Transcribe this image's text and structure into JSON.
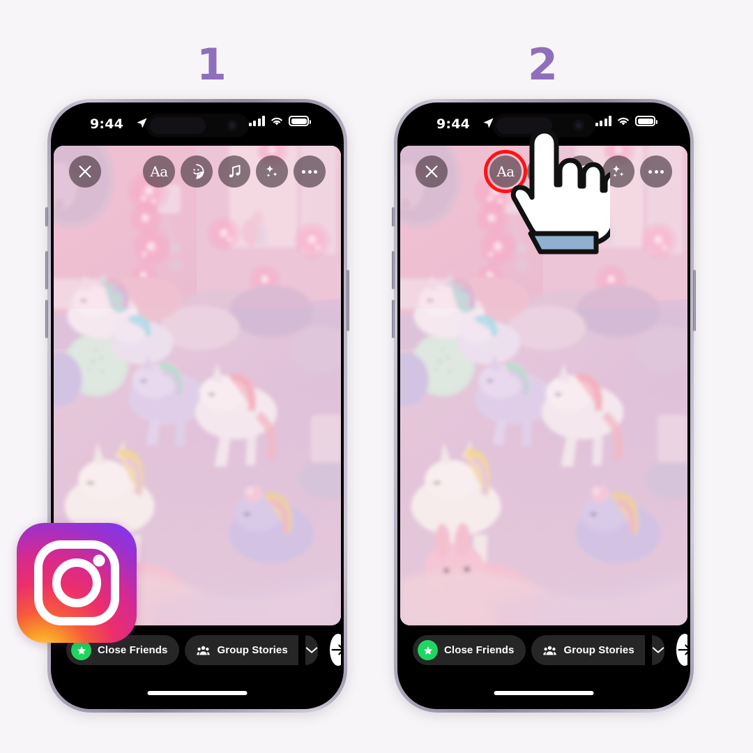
{
  "page": {
    "background_color": "#f7f5f7",
    "accent_color": "#8f6fbc",
    "highlight_color": "#ff1212"
  },
  "steps": [
    {
      "number": "1"
    },
    {
      "number": "2"
    }
  ],
  "status_bar": {
    "time": "9:44",
    "location_icon": "location-arrow-icon",
    "cellular_icon": "signal-bars-icon",
    "wifi_icon": "wifi-icon",
    "battery_icon": "battery-full-icon"
  },
  "story_editor": {
    "close_label": "close-icon",
    "tools": [
      {
        "name": "text-tool",
        "label": "Aa",
        "icon": "text-icon"
      },
      {
        "name": "sticker-tool",
        "label": "",
        "icon": "sticker-icon"
      },
      {
        "name": "music-tool",
        "label": "",
        "icon": "music-note-icon"
      },
      {
        "name": "effects-tool",
        "label": "",
        "icon": "sparkles-icon"
      },
      {
        "name": "more-tool",
        "label": "",
        "icon": "more-dots-icon"
      }
    ],
    "photo_description": "Pastel pink bedroom with unicorn plush toys on a bed, fairy lights on the wall, round mirror and framed art"
  },
  "bottom_bar": {
    "close_friends_label": "Close Friends",
    "close_friends_icon": "star-icon",
    "close_friends_badge_color": "#1ed760",
    "group_stories_label": "Group Stories",
    "group_stories_icon": "group-people-icon",
    "caret_icon": "chevron-down-icon",
    "send_icon": "arrow-right-icon"
  },
  "highlight": {
    "target_tool": "text-tool",
    "cursor_icon": "pointing-hand-cursor"
  },
  "branding": {
    "app_name": "Instagram",
    "logo_icon": "instagram-logo-icon"
  }
}
